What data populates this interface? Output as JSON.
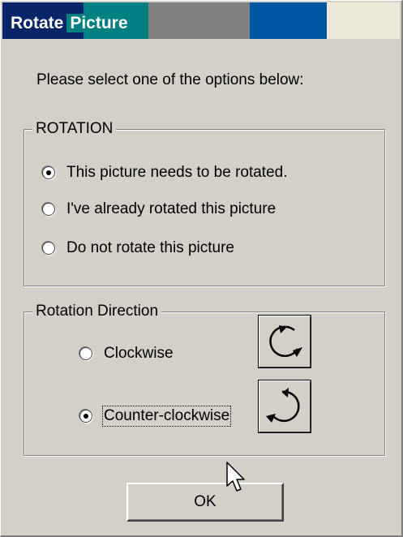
{
  "window": {
    "title_word1": "Rotate",
    "title_word2": "Picture",
    "colors": {
      "face": "#d4d0c8",
      "title_dark": "#0a246a",
      "title_teal": "#008080",
      "title_gray": "#808080",
      "title_blue": "#0055a0",
      "title_light": "#ece9d8"
    }
  },
  "instruction": "Please select one of the options below:",
  "rotation_group": {
    "legend": "ROTATION",
    "options": [
      {
        "label": "This picture needs to be rotated.",
        "selected": true
      },
      {
        "label": "I've already rotated this picture",
        "selected": false
      },
      {
        "label": "Do not rotate this picture",
        "selected": false
      }
    ]
  },
  "direction_group": {
    "legend": "Rotation Direction",
    "options": [
      {
        "label": "Clockwise",
        "selected": false,
        "icon": "rotate-clockwise-icon"
      },
      {
        "label": "Counter-clockwise",
        "selected": true,
        "icon": "rotate-counter-clockwise-icon"
      }
    ]
  },
  "ok_button": {
    "label": "OK"
  },
  "cursor": {
    "icon": "mouse-pointer-icon"
  }
}
